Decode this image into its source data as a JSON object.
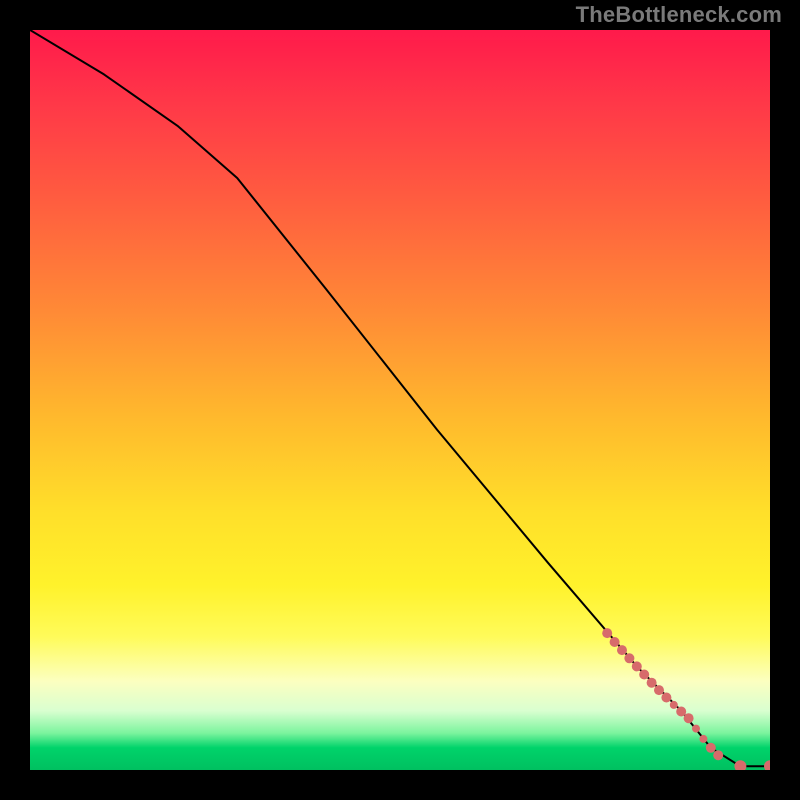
{
  "attribution": "TheBottleneck.com",
  "chart_data": {
    "type": "line",
    "title": "",
    "xlabel": "",
    "ylabel": "",
    "xlim": [
      0,
      100
    ],
    "ylim": [
      0,
      100
    ],
    "curve": {
      "x": [
        0,
        10,
        20,
        28,
        40,
        55,
        70,
        82,
        88,
        92,
        96,
        100
      ],
      "y": [
        100,
        94,
        87,
        80,
        65,
        46,
        28,
        14,
        8,
        3,
        0.5,
        0.5
      ]
    },
    "scatter": {
      "x": [
        78,
        79,
        80,
        81,
        82,
        83,
        84,
        85,
        86,
        87,
        88,
        89,
        90,
        91,
        92,
        93,
        96,
        100
      ],
      "y": [
        18.5,
        17.3,
        16.2,
        15.1,
        14.0,
        12.9,
        11.8,
        10.8,
        9.8,
        8.8,
        7.9,
        7.0,
        5.6,
        4.2,
        3.0,
        2.0,
        0.5,
        0.5
      ],
      "r": [
        5,
        5,
        5,
        5,
        5,
        5,
        5,
        5,
        5,
        4,
        5,
        5,
        4,
        4,
        5,
        5,
        6,
        6
      ]
    },
    "gradient_stops": [
      {
        "pos": 0,
        "color": "#ff1a4b"
      },
      {
        "pos": 10,
        "color": "#ff3848"
      },
      {
        "pos": 22,
        "color": "#ff5a40"
      },
      {
        "pos": 38,
        "color": "#ff8a36"
      },
      {
        "pos": 52,
        "color": "#ffb82d"
      },
      {
        "pos": 65,
        "color": "#ffdf2a"
      },
      {
        "pos": 75,
        "color": "#fff22b"
      },
      {
        "pos": 82,
        "color": "#fffb5a"
      },
      {
        "pos": 88,
        "color": "#fcffc0"
      },
      {
        "pos": 92,
        "color": "#d9ffd0"
      },
      {
        "pos": 95,
        "color": "#7cf49e"
      },
      {
        "pos": 97,
        "color": "#00d36a"
      },
      {
        "pos": 100,
        "color": "#00c060"
      }
    ]
  }
}
